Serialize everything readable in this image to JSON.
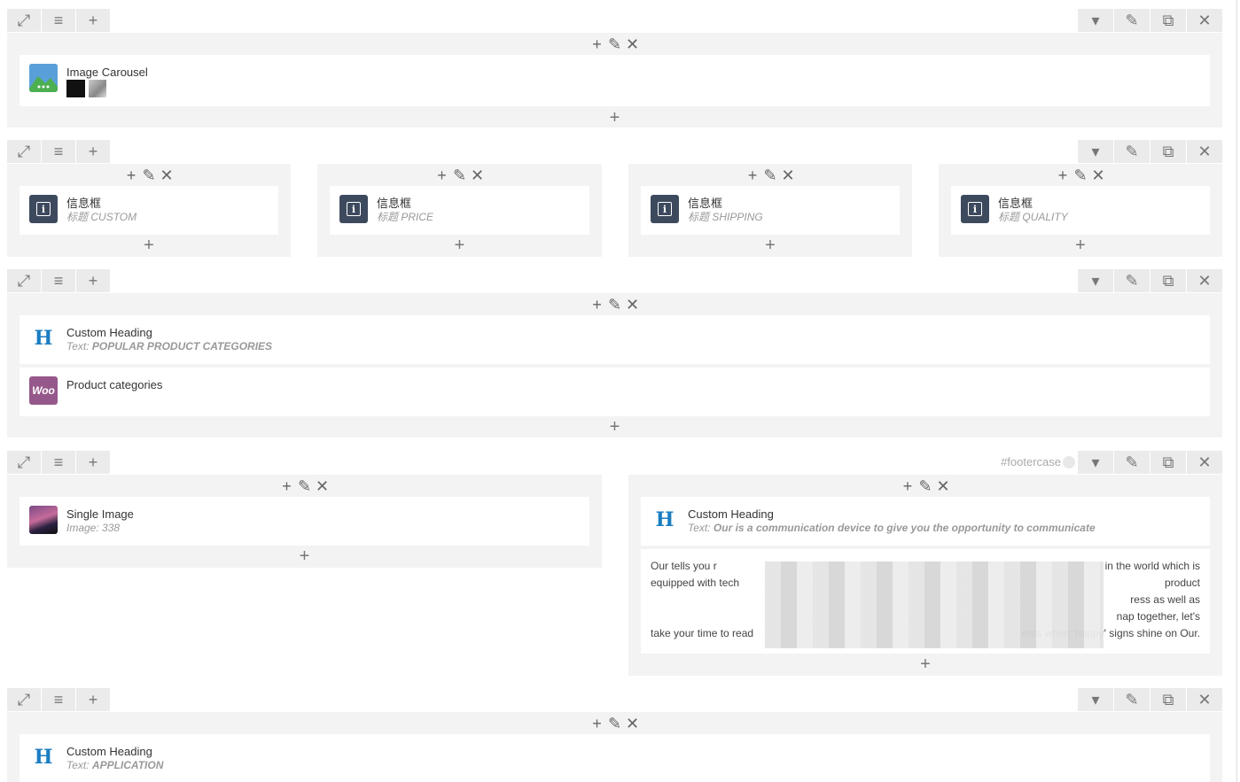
{
  "icons": {
    "expand": "⤢",
    "drag": "≡",
    "add": "+",
    "caret": "▾",
    "edit": "✎",
    "clone": "⧉",
    "close": "✕"
  },
  "row1": {
    "element": {
      "title": "Image Carousel"
    }
  },
  "row2": {
    "columns": [
      {
        "title": "信息框",
        "sub_prefix": "标题",
        "sub_value": "CUSTOM"
      },
      {
        "title": "信息框",
        "sub_prefix": "标题",
        "sub_value": "PRICE"
      },
      {
        "title": "信息框",
        "sub_prefix": "标题",
        "sub_value": "SHIPPING"
      },
      {
        "title": "信息框",
        "sub_prefix": "标题",
        "sub_value": "QUALITY"
      }
    ]
  },
  "row3": {
    "heading": {
      "title": "Custom Heading",
      "sub_prefix": "Text:",
      "sub_value": "POPULAR PRODUCT CATEGORIES"
    },
    "woo": {
      "title": "Product categories",
      "icon_text": "Woo"
    }
  },
  "row4": {
    "anchor": "#footercase",
    "left": {
      "title": "Single Image",
      "sub": "Image: 338"
    },
    "right": {
      "heading": {
        "title": "Custom Heading",
        "sub_prefix": "Text:",
        "sub_value": "Our is a communication device to give you the opportunity to communicate"
      },
      "text_lines": [
        "Our tells you r",
        "in the world which is",
        "equipped with tech",
        "product",
        "ress as well as",
        "nap together, let's",
        "take your time to read",
        "ents when 'happy' signs shine on Our."
      ]
    }
  },
  "row5": {
    "heading": {
      "title": "Custom Heading",
      "sub_prefix": "Text:",
      "sub_value": "APPLICATION"
    }
  }
}
